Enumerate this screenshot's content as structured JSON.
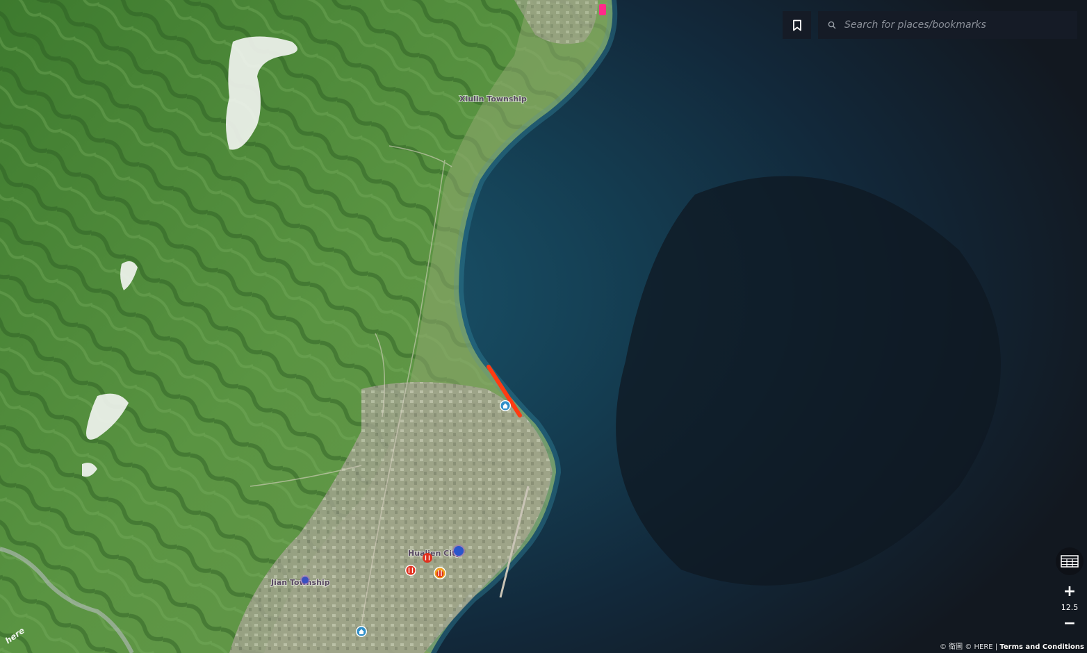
{
  "map": {
    "labels": {
      "xiulin": "Xiulin Township",
      "hualien": "Hualien City",
      "jian": "Jian Township"
    },
    "colors": {
      "sea_deep": "#121a22",
      "sea_shallow": "#1e5b73",
      "land_green": "#4f8a3a",
      "urban": "#b9b3a6",
      "highlight_route": "#ff3b12",
      "marker_pink": "#ff2a8a"
    },
    "icons": [
      "bookmark-icon",
      "search-icon",
      "table-icon",
      "restaurant-icon",
      "home-icon",
      "city-marker-icon"
    ]
  },
  "search": {
    "placeholder": "Search for places/bookmarks"
  },
  "zoom": {
    "plus": "+",
    "level": "12.5",
    "minus": "−"
  },
  "attribution": {
    "copyright": "© 衛圖 © HERE",
    "separator": "|",
    "terms": "Terms and Conditions"
  },
  "logo": {
    "text": "here"
  }
}
